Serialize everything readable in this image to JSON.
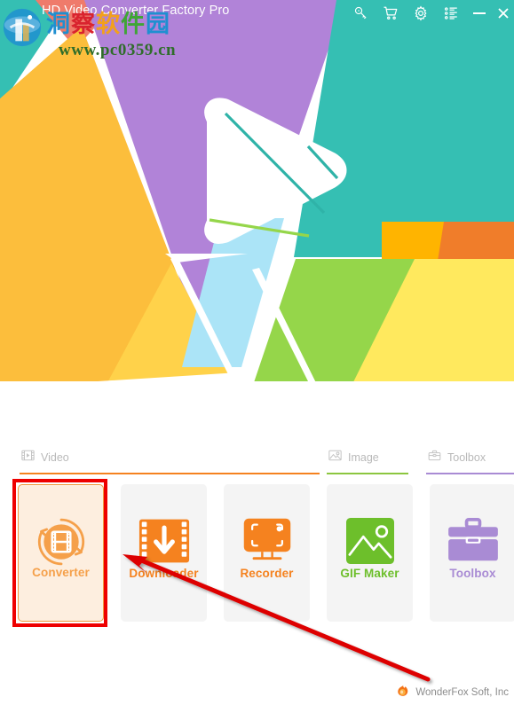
{
  "window": {
    "title": "HD Video Converter Factory Pro",
    "titlebar_color": "#35bfb3",
    "titlebar_corner_color": "#189c9c",
    "controls": [
      {
        "name": "register-key-icon",
        "label": "Register",
        "glyph": "key-icon"
      },
      {
        "name": "cart-icon",
        "label": "Buy",
        "glyph": "cart-icon"
      },
      {
        "name": "gear-icon",
        "label": "Settings",
        "glyph": "gear-icon"
      },
      {
        "name": "menu-list-icon",
        "label": "Menu",
        "glyph": "list-icon"
      },
      {
        "name": "minimize-button",
        "label": "Minimize",
        "glyph": "minimize-icon"
      },
      {
        "name": "close-button",
        "label": "Close",
        "glyph": "close-icon"
      }
    ]
  },
  "watermark": {
    "chinese": [
      "洞",
      "察",
      "软",
      "件",
      "园"
    ],
    "url": "www.pc0359.cn"
  },
  "hero": {
    "logo": "play-triangle-logo",
    "palette": {
      "teal": "#35bfb3",
      "teal_dark": "#189c9c",
      "purple": "#b183d8",
      "amber": "#fcbe3c",
      "yellow": "#ffd84d",
      "yellow_light": "#ffe95e",
      "sky": "#abe4f7",
      "green": "#95d64a",
      "orange": "#f5821f",
      "orange_deep": "#f07d2a",
      "gold": "#ffb400",
      "coral": "#ef7b6b"
    }
  },
  "tabs": [
    {
      "id": "video",
      "label": "Video",
      "icon": "film-strip-icon",
      "accent": "#f5821f",
      "active": true
    },
    {
      "id": "image",
      "label": "Image",
      "icon": "picture-icon",
      "accent": "#8cc63f",
      "active": false
    },
    {
      "id": "toolbox",
      "label": "Toolbox",
      "icon": "briefcase-icon",
      "accent": "#a98bd4",
      "active": false
    }
  ],
  "cards": [
    {
      "id": "converter",
      "label": "Converter",
      "icon": "converter-icon",
      "color": "#f5a04a",
      "selected": true
    },
    {
      "id": "downloader",
      "label": "Downloader",
      "icon": "downloader-icon",
      "color": "#f5821f",
      "selected": false
    },
    {
      "id": "recorder",
      "label": "Recorder",
      "icon": "recorder-icon",
      "color": "#f5821f",
      "selected": false
    },
    {
      "id": "gifmaker",
      "label": "GIF Maker",
      "icon": "gif-maker-icon",
      "color": "#6dbf2b",
      "selected": false
    },
    {
      "id": "toolbox",
      "label": "Toolbox",
      "icon": "toolbox-icon",
      "color": "#a98bd4",
      "selected": false
    }
  ],
  "annotations": {
    "highlight_target": "converter",
    "arrow_color": "#dd0000",
    "box_color": "#ee0000"
  },
  "footer": {
    "brand": "WonderFox Soft, Inc",
    "logo": "wonderfox-flame-icon"
  }
}
